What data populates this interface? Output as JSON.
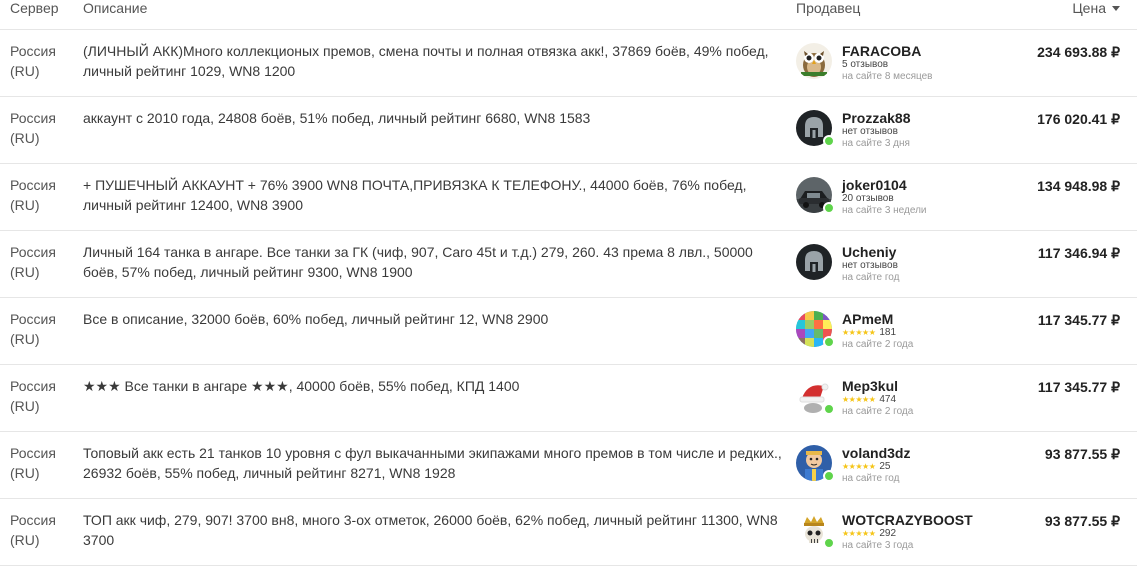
{
  "header": {
    "server": "Сервер",
    "description": "Описание",
    "seller": "Продавец",
    "price": "Цена"
  },
  "rows": [
    {
      "server_line1": "Россия",
      "server_line2": "(RU)",
      "description": "(ЛИЧНЫЙ АКК)Много коллекционых премов, смена почты и полная отвязка акк!, 37869 боёв, 49% побед, личный рейтинг 1029, WN8 1200",
      "seller": "FARACOBA",
      "sub": "5 отзывов",
      "rating": "",
      "since": "на сайте 8 месяцев",
      "price": "234 693.88 ₽",
      "avatar": "owl-avatar"
    },
    {
      "server_line1": "Россия",
      "server_line2": "(RU)",
      "description": "аккаунт с 2010 года, 24808 боёв, 51% побед, личный рейтинг 6680, WN8 1583",
      "seller": "Prozzak88",
      "sub": "нет отзывов",
      "rating": "",
      "since": "на сайте 3 дня",
      "price": "176 020.41 ₽",
      "avatar": "helmet-avatar"
    },
    {
      "server_line1": "Россия",
      "server_line2": "(RU)",
      "description": "+ ПУШЕЧНЫЙ АККАУНТ + 76% 3900 WN8 ПОЧТА,ПРИВЯЗКА К ТЕЛЕФОНУ., 44000 боёв, 76% побед, личный рейтинг 12400, WN8 3900",
      "seller": "joker0104",
      "sub": "20 отзывов",
      "rating": "",
      "since": "на сайте 3 недели",
      "price": "134 948.98 ₽",
      "avatar": "car-avatar"
    },
    {
      "server_line1": "Россия",
      "server_line2": "(RU)",
      "description": "Личный 164 танка в ангаре. Все танки за ГК (чиф, 907, Caro 45t и т.д.) 279, 260. 43 према 8 лвл., 50000 боёв, 57% побед, личный рейтинг 9300, WN8 1900",
      "seller": "Ucheniy",
      "sub": "нет отзывов",
      "rating": "",
      "since": "на сайте год",
      "price": "117 346.94 ₽",
      "avatar": "helmet-avatar"
    },
    {
      "server_line1": "Россия",
      "server_line2": "(RU)",
      "description": "Все в описание, 32000 боёв, 60% побед, личный рейтинг 12, WN8 2900",
      "seller": "APmeM",
      "sub": "",
      "rating": "181",
      "since": "на сайте 2 года",
      "price": "117 345.77 ₽",
      "avatar": "mosaic-avatar"
    },
    {
      "server_line1": "Россия",
      "server_line2": "(RU)",
      "description": "★★★ Все танки в ангаре ★★★, 40000 боёв, 55% побед, КПД 1400",
      "seller": "Mep3kul",
      "sub": "",
      "rating": "474",
      "since": "на сайте 2 года",
      "price": "117 345.77 ₽",
      "avatar": "santa-hat-avatar"
    },
    {
      "server_line1": "Россия",
      "server_line2": "(RU)",
      "description": "Топовый акк есть 21 танков 10 уровня с фул выкачанными экипажами много премов в том числе и редких., 26932 боёв, 55% побед, личный рейтинг 8271, WN8 1928",
      "seller": "voland3dz",
      "sub": "",
      "rating": "25",
      "since": "на сайте год",
      "price": "93 877.55 ₽",
      "avatar": "cartoon-avatar"
    },
    {
      "server_line1": "Россия",
      "server_line2": "(RU)",
      "description": "ТОП акк чиф, 279, 907! 3700 вн8, много 3-ох отметок, 26000 боёв, 62% побед, личный рейтинг 11300, WN8 3700",
      "seller": "WOTCRAZYBOOST",
      "sub": "",
      "rating": "292",
      "since": "на сайте 3 года",
      "price": "93 877.55 ₽",
      "avatar": "skull-crown-avatar"
    }
  ],
  "stars_glyph": "★★★★★",
  "colors": {
    "online": "#5fd44b",
    "stars": "#f5c518",
    "divider": "#e6e6e6"
  }
}
